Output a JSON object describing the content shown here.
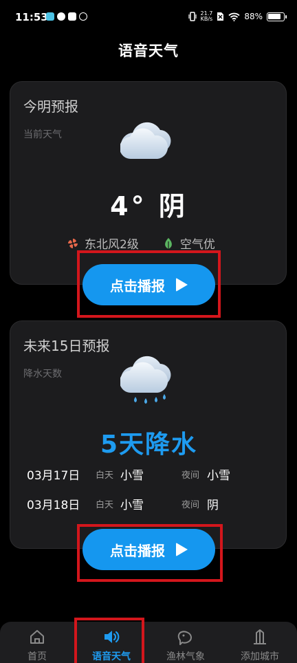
{
  "status_bar": {
    "time": "11:53",
    "net_speed_value": "21.7",
    "net_speed_unit": "KB/s",
    "battery": "88%"
  },
  "page": {
    "title": "语音天气"
  },
  "today_card": {
    "title": "今明预报",
    "subtitle": "当前天气",
    "temperature": "4°",
    "condition": "阴",
    "wind": "东北风2级",
    "air": "空气优",
    "play_label": "点击播报",
    "icon": "cloud-icon"
  },
  "forecast_card": {
    "title": "未来15日预报",
    "subtitle": "降水天数",
    "precip_summary": "5天降水",
    "icon": "cloud-rain-icon",
    "day_label": "白天",
    "night_label": "夜间",
    "rows": [
      {
        "date": "03月17日",
        "day": "小雪",
        "night": "小雪"
      },
      {
        "date": "03月18日",
        "day": "小雪",
        "night": "阴"
      }
    ],
    "play_label": "点击播报"
  },
  "tabs": [
    {
      "label": "首页",
      "icon": "home-icon",
      "active": false
    },
    {
      "label": "语音天气",
      "icon": "speaker-icon",
      "active": true
    },
    {
      "label": "渔林气象",
      "icon": "fish-icon",
      "active": false
    },
    {
      "label": "添加城市",
      "icon": "building-icon",
      "active": false
    }
  ],
  "colors": {
    "accent": "#1597ef",
    "highlight": "#d3161c",
    "card": "#1c1c1e"
  }
}
